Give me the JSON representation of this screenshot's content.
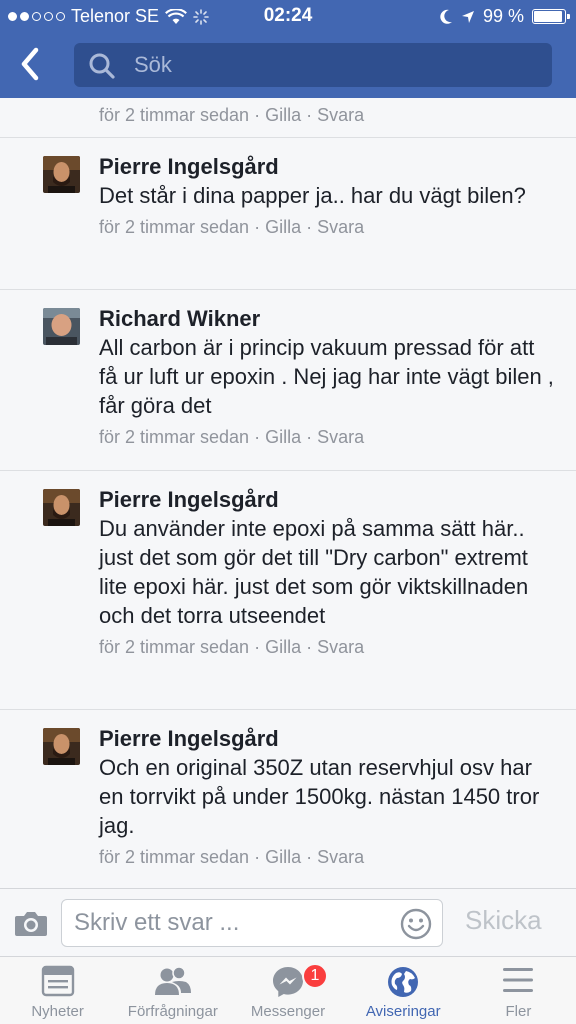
{
  "status_bar": {
    "carrier": "Telenor SE",
    "time": "02:24",
    "battery": "99 %"
  },
  "header": {
    "search_placeholder": "Sök"
  },
  "partial_comment": {
    "time": "för 2 timmar sedan",
    "like": "Gilla",
    "reply": "Svara",
    "sep": "·"
  },
  "comments": [
    {
      "author": "Pierre Ingelsgård",
      "text": "Det står i dina papper ja.. har du vägt bilen?",
      "time": "för 2 timmar sedan",
      "like": "Gilla",
      "reply": "Svara"
    },
    {
      "author": "Richard Wikner",
      "text": "All carbon är i princip vakuum pressad för att få ur luft ur epoxin . Nej jag har inte vägt bilen , får göra det",
      "time": "för 2 timmar sedan",
      "like": "Gilla",
      "reply": "Svara"
    },
    {
      "author": "Pierre Ingelsgård",
      "text": "Du använder inte epoxi på samma sätt här.. just det som gör det till \"Dry carbon\" extremt lite epoxi här. just det som gör viktskillnaden och det torra utseendet",
      "time": "för 2 timmar sedan",
      "like": "Gilla",
      "reply": "Svara"
    },
    {
      "author": "Pierre Ingelsgård",
      "text": "Och en original 350Z utan reservhjul osv har en torrvikt på under 1500kg.  nästan 1450 tror jag.",
      "time": "för 2 timmar sedan",
      "like": "Gilla",
      "reply": "Svara"
    }
  ],
  "reply_bar": {
    "placeholder": "Skriv ett svar ...",
    "send_label": "Skicka"
  },
  "tabs": [
    {
      "label": "Nyheter",
      "icon": "news-feed-icon"
    },
    {
      "label": "Förfrågningar",
      "icon": "friend-requests-icon"
    },
    {
      "label": "Messenger",
      "icon": "messenger-icon",
      "badge": "1"
    },
    {
      "label": "Aviseringar",
      "icon": "globe-icon",
      "active": true
    },
    {
      "label": "Fler",
      "icon": "menu-icon"
    }
  ],
  "colors": {
    "brand": "#4267b2",
    "badge": "#fa3e3e",
    "meta_text": "#90949c"
  }
}
